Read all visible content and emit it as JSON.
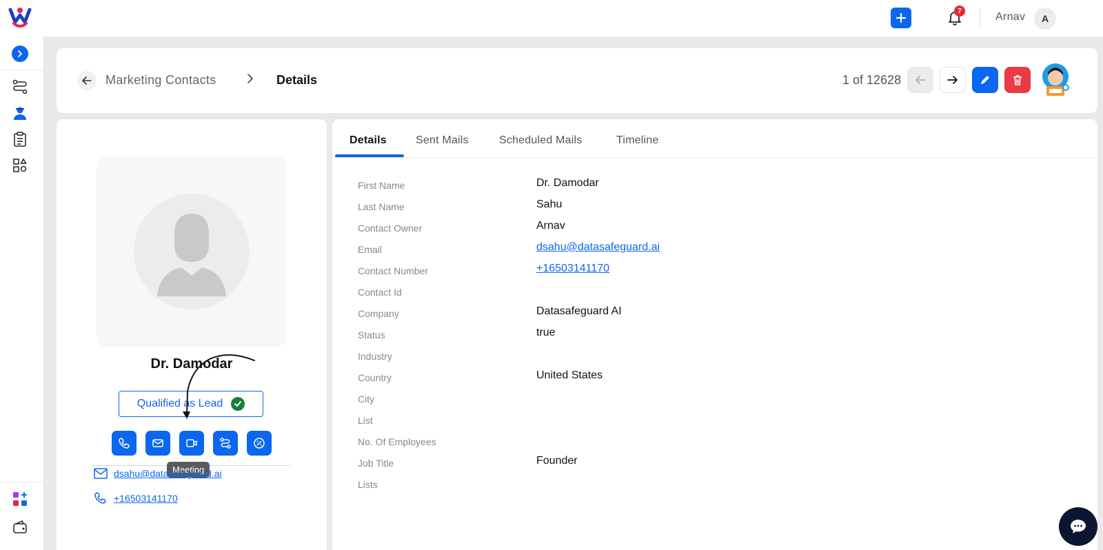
{
  "topbar": {
    "notifications_count": "7",
    "user_name": "Arnav",
    "user_initial": "A"
  },
  "breadcrumb": {
    "parent": "Marketing Contacts",
    "current": "Details"
  },
  "pager": {
    "text": "1 of 12628"
  },
  "profile": {
    "name": "Dr. Damodar",
    "lead_status": "Qualified as Lead",
    "tooltip": "Meeting",
    "email": "dsahu@datasafeguard.ai",
    "phone": "+16503141170"
  },
  "tabs": [
    "Details",
    "Sent Mails",
    "Scheduled Mails",
    "Timeline"
  ],
  "fields": [
    {
      "label": "First Name",
      "value": "Dr. Damodar"
    },
    {
      "label": "Last Name",
      "value": "Sahu"
    },
    {
      "label": "Contact Owner",
      "value": "Arnav"
    },
    {
      "label": "Email",
      "value": "dsahu@datasafeguard.ai"
    },
    {
      "label": "Contact Number",
      "value": "+16503141170"
    },
    {
      "label": "Contact Id",
      "value": ""
    },
    {
      "label": "Company",
      "value": "Datasafeguard AI"
    },
    {
      "label": "Status",
      "value": "true"
    },
    {
      "label": "Industry",
      "value": ""
    },
    {
      "label": "Country",
      "value": "United States"
    },
    {
      "label": "City",
      "value": ""
    },
    {
      "label": "List",
      "value": ""
    },
    {
      "label": "No. Of Employees",
      "value": ""
    },
    {
      "label": "Job Title",
      "value": "Founder"
    },
    {
      "label": "Lists",
      "value": ""
    }
  ],
  "colors": {
    "accent": "#0b66f0",
    "danger": "#e93a45",
    "success": "#15803d"
  },
  "icons": [
    "app-logo",
    "plus-icon",
    "bell-icon",
    "chevron-right-icon",
    "workflow-icon",
    "contacts-icon",
    "clipboard-icon",
    "shapes-icon",
    "apps-add-icon",
    "wallet-icon",
    "arrow-left-icon",
    "arrow-right-icon",
    "pencil-icon",
    "trash-icon",
    "phone-icon",
    "mail-icon",
    "video-icon",
    "route-icon",
    "percent-badge-icon",
    "chat-icon"
  ]
}
